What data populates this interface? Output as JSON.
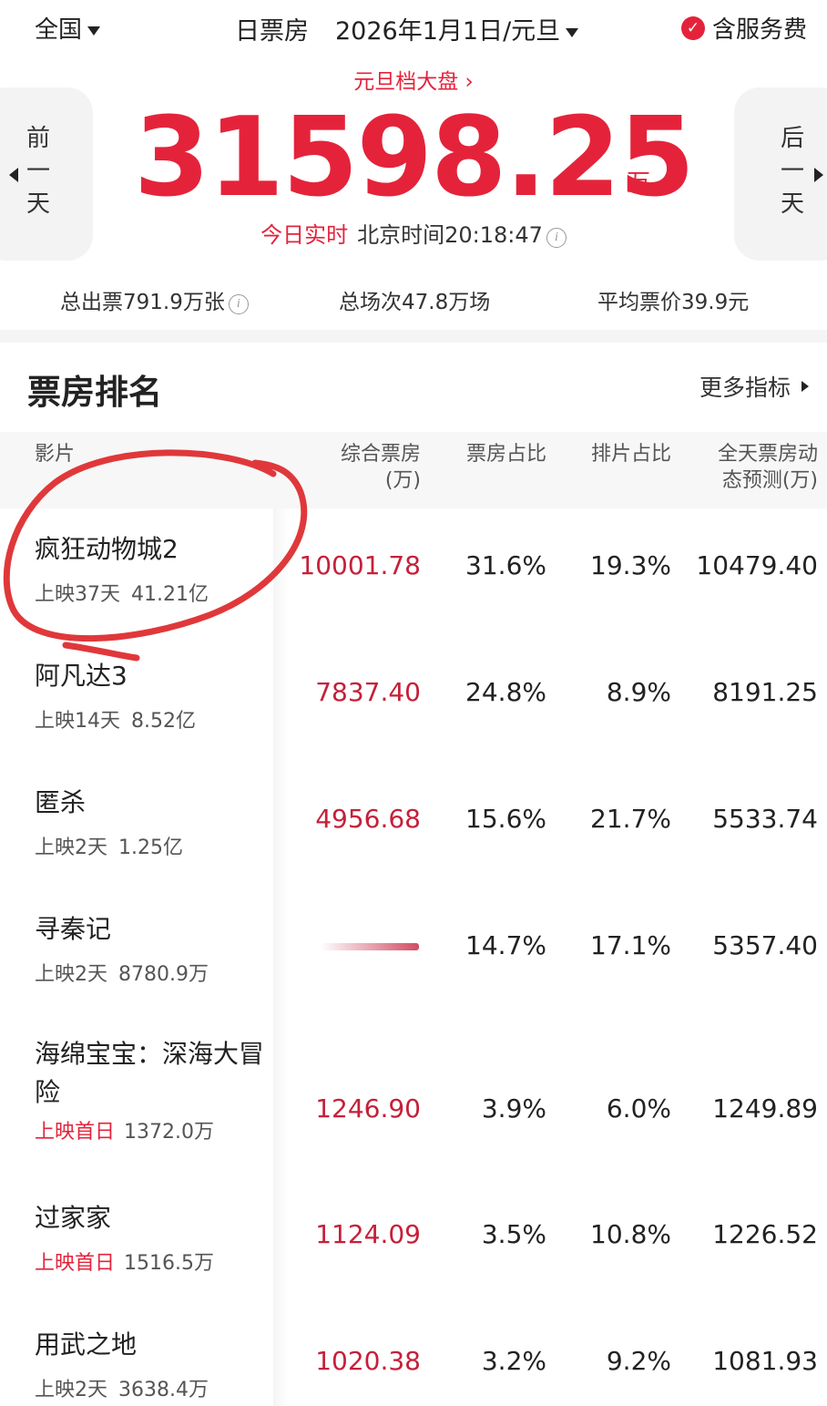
{
  "topbar": {
    "region": "全国",
    "type": "日票房",
    "date": "2026年1月1日/元旦",
    "service": "含服务费",
    "check_icon": "check-icon"
  },
  "hero": {
    "link": "元旦档大盘",
    "prev_label": "前一天",
    "next_label": "后一天",
    "total": "31598.25",
    "unit": "万",
    "realtime_label": "今日实时",
    "time_label": "北京时间20:18:47"
  },
  "stats": {
    "tickets": "总出票791.9万张",
    "shows": "总场次47.8万场",
    "avg_price": "平均票价39.9元"
  },
  "section": {
    "title": "票房排名",
    "more": "更多指标"
  },
  "table": {
    "headers": {
      "film": "影片",
      "box_line1": "综合票房",
      "box_line2": "(万)",
      "share": "票房占比",
      "schedule": "排片占比",
      "forecast_line1": "全天票房动",
      "forecast_line2": "态预测(万)"
    },
    "rows": [
      {
        "name": "疯狂动物城2",
        "days": "上映37天",
        "total": "41.21亿",
        "box": "10001.78",
        "share": "31.6%",
        "schedule": "19.3%",
        "forecast": "10479.40",
        "first_day": false
      },
      {
        "name": "阿凡达3",
        "days": "上映14天",
        "total": "8.52亿",
        "box": "7837.40",
        "share": "24.8%",
        "schedule": "8.9%",
        "forecast": "8191.25",
        "first_day": false
      },
      {
        "name": "匿杀",
        "days": "上映2天",
        "total": "1.25亿",
        "box": "4956.68",
        "share": "15.6%",
        "schedule": "21.7%",
        "forecast": "5533.74",
        "first_day": false
      },
      {
        "name": "寻秦记",
        "days": "上映2天",
        "total": "8780.9万",
        "box": "",
        "share": "14.7%",
        "schedule": "17.1%",
        "forecast": "5357.40",
        "first_day": false
      },
      {
        "name": "海绵宝宝：深海大冒险",
        "days": "上映首日",
        "total": "1372.0万",
        "box": "1246.90",
        "share": "3.9%",
        "schedule": "6.0%",
        "forecast": "1249.89",
        "first_day": true
      },
      {
        "name": "过家家",
        "days": "上映首日",
        "total": "1516.5万",
        "box": "1124.09",
        "share": "3.5%",
        "schedule": "10.8%",
        "forecast": "1226.52",
        "first_day": true
      },
      {
        "name": "用武之地",
        "days": "上映2天",
        "total": "3638.4万",
        "box": "1020.38",
        "share": "3.2%",
        "schedule": "9.2%",
        "forecast": "1081.93",
        "first_day": false
      }
    ]
  },
  "colors": {
    "accent": "#e4233b",
    "box_value": "#c5203a",
    "annotation": "#e0383a"
  }
}
